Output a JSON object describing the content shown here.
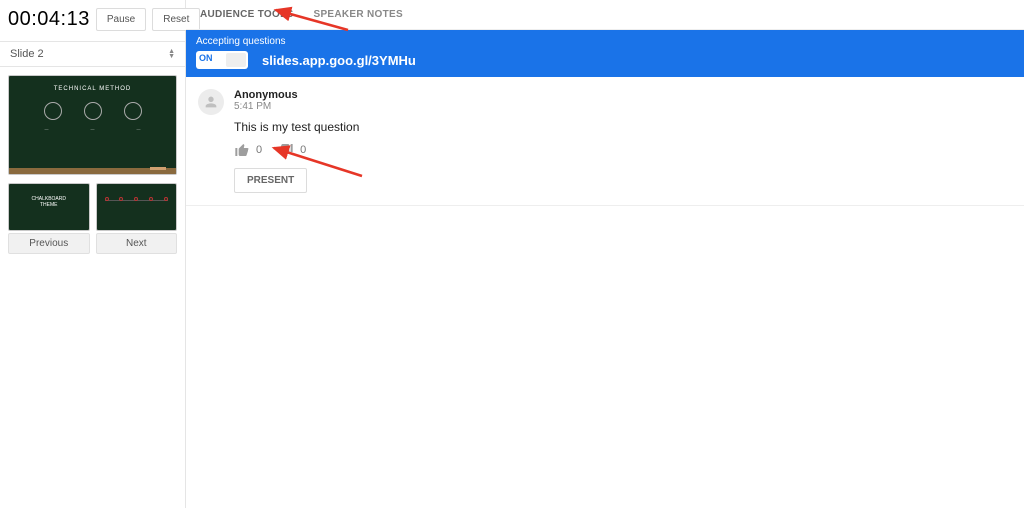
{
  "sidebar": {
    "timer": "00:04:13",
    "pause_label": "Pause",
    "reset_label": "Reset",
    "slide_selector": "Slide 2",
    "main_slide_title": "TECHNICAL METHOD",
    "prev_label": "Previous",
    "next_label": "Next",
    "prev_thumb_text": "CHALKBOARD\nTHEME"
  },
  "tabs": {
    "audience": "AUDIENCE TOOLS",
    "notes": "SPEAKER NOTES"
  },
  "qa": {
    "accepting": "Accepting questions",
    "toggle_on": "ON",
    "url": "slides.app.goo.gl/3YMHu"
  },
  "question": {
    "author": "Anonymous",
    "time": "5:41 PM",
    "text": "This is my test question",
    "up_count": "0",
    "down_count": "0",
    "present_label": "PRESENT"
  }
}
